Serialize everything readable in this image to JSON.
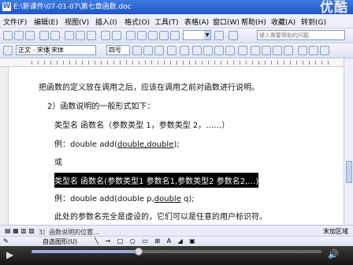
{
  "window": {
    "title": "E:\\新课件\\07-01-07\\第七章函数.doc",
    "app_icon": "W",
    "watermark": "优酷"
  },
  "menu": [
    "文件(F)",
    "编辑(E)",
    "视图(V)",
    "插入(I)",
    "格式(O)",
    "工具(T)",
    "表格(A)",
    "窗口(W)",
    "帮助(H)",
    "收藏(A)",
    "转到(G)"
  ],
  "toolbar": {
    "style_value": "正文 - 宋体",
    "font_value": "宋体",
    "size_value": "四号",
    "help_placeholder": "键入需要帮助的问题"
  },
  "document": {
    "lines": [
      {
        "text": "把函数的定义放在调用之后，应该在调用之前对函数进行说明。"
      },
      {
        "text": "2）函数说明的一般形式如下："
      },
      {
        "text": "类型名  函数名（参数类型 1，参数类型 2，……）"
      },
      {
        "pre": "例：double  add(",
        "ul": "double,double",
        "post": ");"
      },
      {
        "text": "或"
      },
      {
        "text": "类型名 函数名(参数类型1 参数名1,参数类型2 参数名2,…)",
        "highlight": true
      },
      {
        "pre": "例：double  add(double  p,",
        "ul": "double",
        "post": "  q);"
      },
      {
        "text": "此处的参数名完全是虚设的，它们可以是任意的用户标识符。"
      }
    ],
    "partial_line": "3）函数说明的位置…"
  },
  "statusbar": {
    "text": "末加区域"
  },
  "drawbar": {
    "label": "自选图形(U)"
  },
  "player": {
    "progress": 0.37
  }
}
